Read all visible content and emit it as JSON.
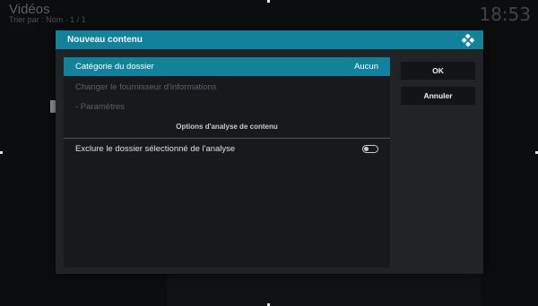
{
  "background": {
    "title": "Vidéos",
    "subtitle": "Trier par : Nom  ·  1 / 1",
    "clock": "18:53"
  },
  "dialog": {
    "title": "Nouveau contenu",
    "logo_icon": "kodi-logo-icon",
    "accent_color": "#12829c",
    "rows": [
      {
        "label": "Catégorie du dossier",
        "value": "Aucun",
        "state": "selected"
      },
      {
        "label": "Changer le fournisseur d'informations",
        "value": "",
        "state": "disabled"
      },
      {
        "label": "- Paramètres",
        "value": "",
        "state": "disabled"
      }
    ],
    "section_header": "Options d'analyse de contenu",
    "exclude_row": {
      "label": "Exclure le dossier sélectionné de l'analyse",
      "toggle_on": false
    },
    "buttons": {
      "ok": "OK",
      "cancel": "Annuler"
    }
  }
}
